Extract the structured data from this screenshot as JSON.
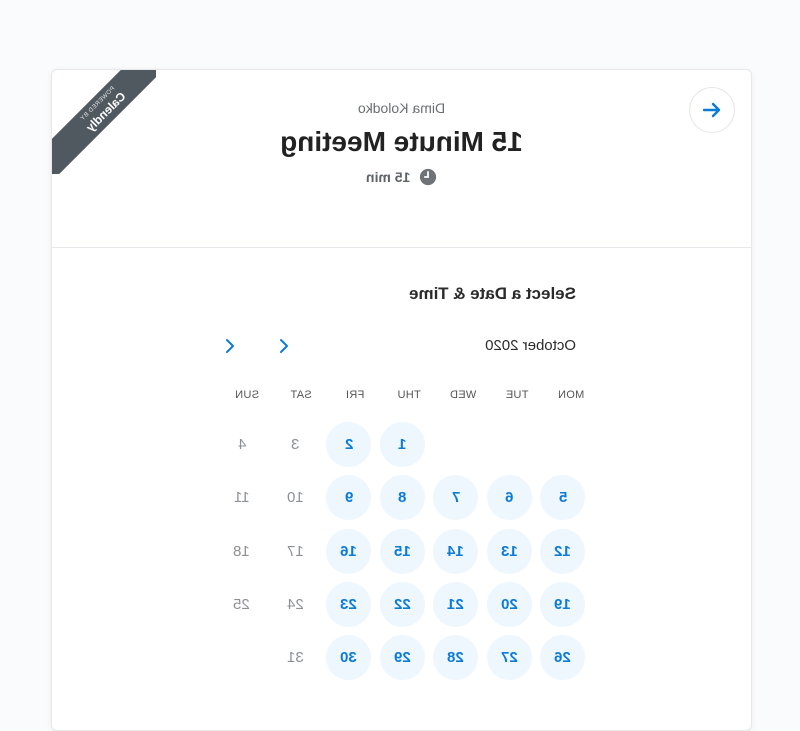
{
  "badge": {
    "powered_by": "POWERED BY",
    "brand": "Calendly"
  },
  "event": {
    "host": "Dima Kolodko",
    "title": "15 Minute Meeting",
    "duration": "15 min"
  },
  "calendar": {
    "heading": "Select a Date & Time",
    "month_label": "October 2020",
    "weekdays_display": [
      "SUN",
      "SAT",
      "FRI",
      "THU",
      "WED",
      "TUE",
      "MON"
    ],
    "weeks": [
      [
        {
          "d": "4",
          "a": false
        },
        {
          "d": "3",
          "a": false
        },
        {
          "d": "2",
          "a": true
        },
        {
          "d": "1",
          "a": true
        },
        {
          "d": "",
          "a": false
        },
        {
          "d": "",
          "a": false
        },
        {
          "d": "",
          "a": false
        }
      ],
      [
        {
          "d": "11",
          "a": false
        },
        {
          "d": "10",
          "a": false
        },
        {
          "d": "9",
          "a": true
        },
        {
          "d": "8",
          "a": true
        },
        {
          "d": "7",
          "a": true
        },
        {
          "d": "6",
          "a": true
        },
        {
          "d": "5",
          "a": true
        }
      ],
      [
        {
          "d": "18",
          "a": false
        },
        {
          "d": "17",
          "a": false
        },
        {
          "d": "16",
          "a": true
        },
        {
          "d": "15",
          "a": true
        },
        {
          "d": "14",
          "a": true
        },
        {
          "d": "13",
          "a": true
        },
        {
          "d": "12",
          "a": true
        }
      ],
      [
        {
          "d": "25",
          "a": false
        },
        {
          "d": "24",
          "a": false
        },
        {
          "d": "23",
          "a": true
        },
        {
          "d": "22",
          "a": true
        },
        {
          "d": "21",
          "a": true
        },
        {
          "d": "20",
          "a": true
        },
        {
          "d": "19",
          "a": true
        }
      ],
      [
        {
          "d": "",
          "a": false
        },
        {
          "d": "31",
          "a": false
        },
        {
          "d": "30",
          "a": true
        },
        {
          "d": "29",
          "a": true
        },
        {
          "d": "28",
          "a": true
        },
        {
          "d": "27",
          "a": true
        },
        {
          "d": "26",
          "a": true
        }
      ]
    ]
  },
  "icons": {
    "next": "arrow-right-icon",
    "clock": "clock-icon",
    "prev_month": "chevron-left-icon",
    "next_month": "chevron-right-icon"
  },
  "colors": {
    "accent": "#0b7bd8",
    "available_bg": "#eef6fe",
    "ribbon": "#505860"
  }
}
